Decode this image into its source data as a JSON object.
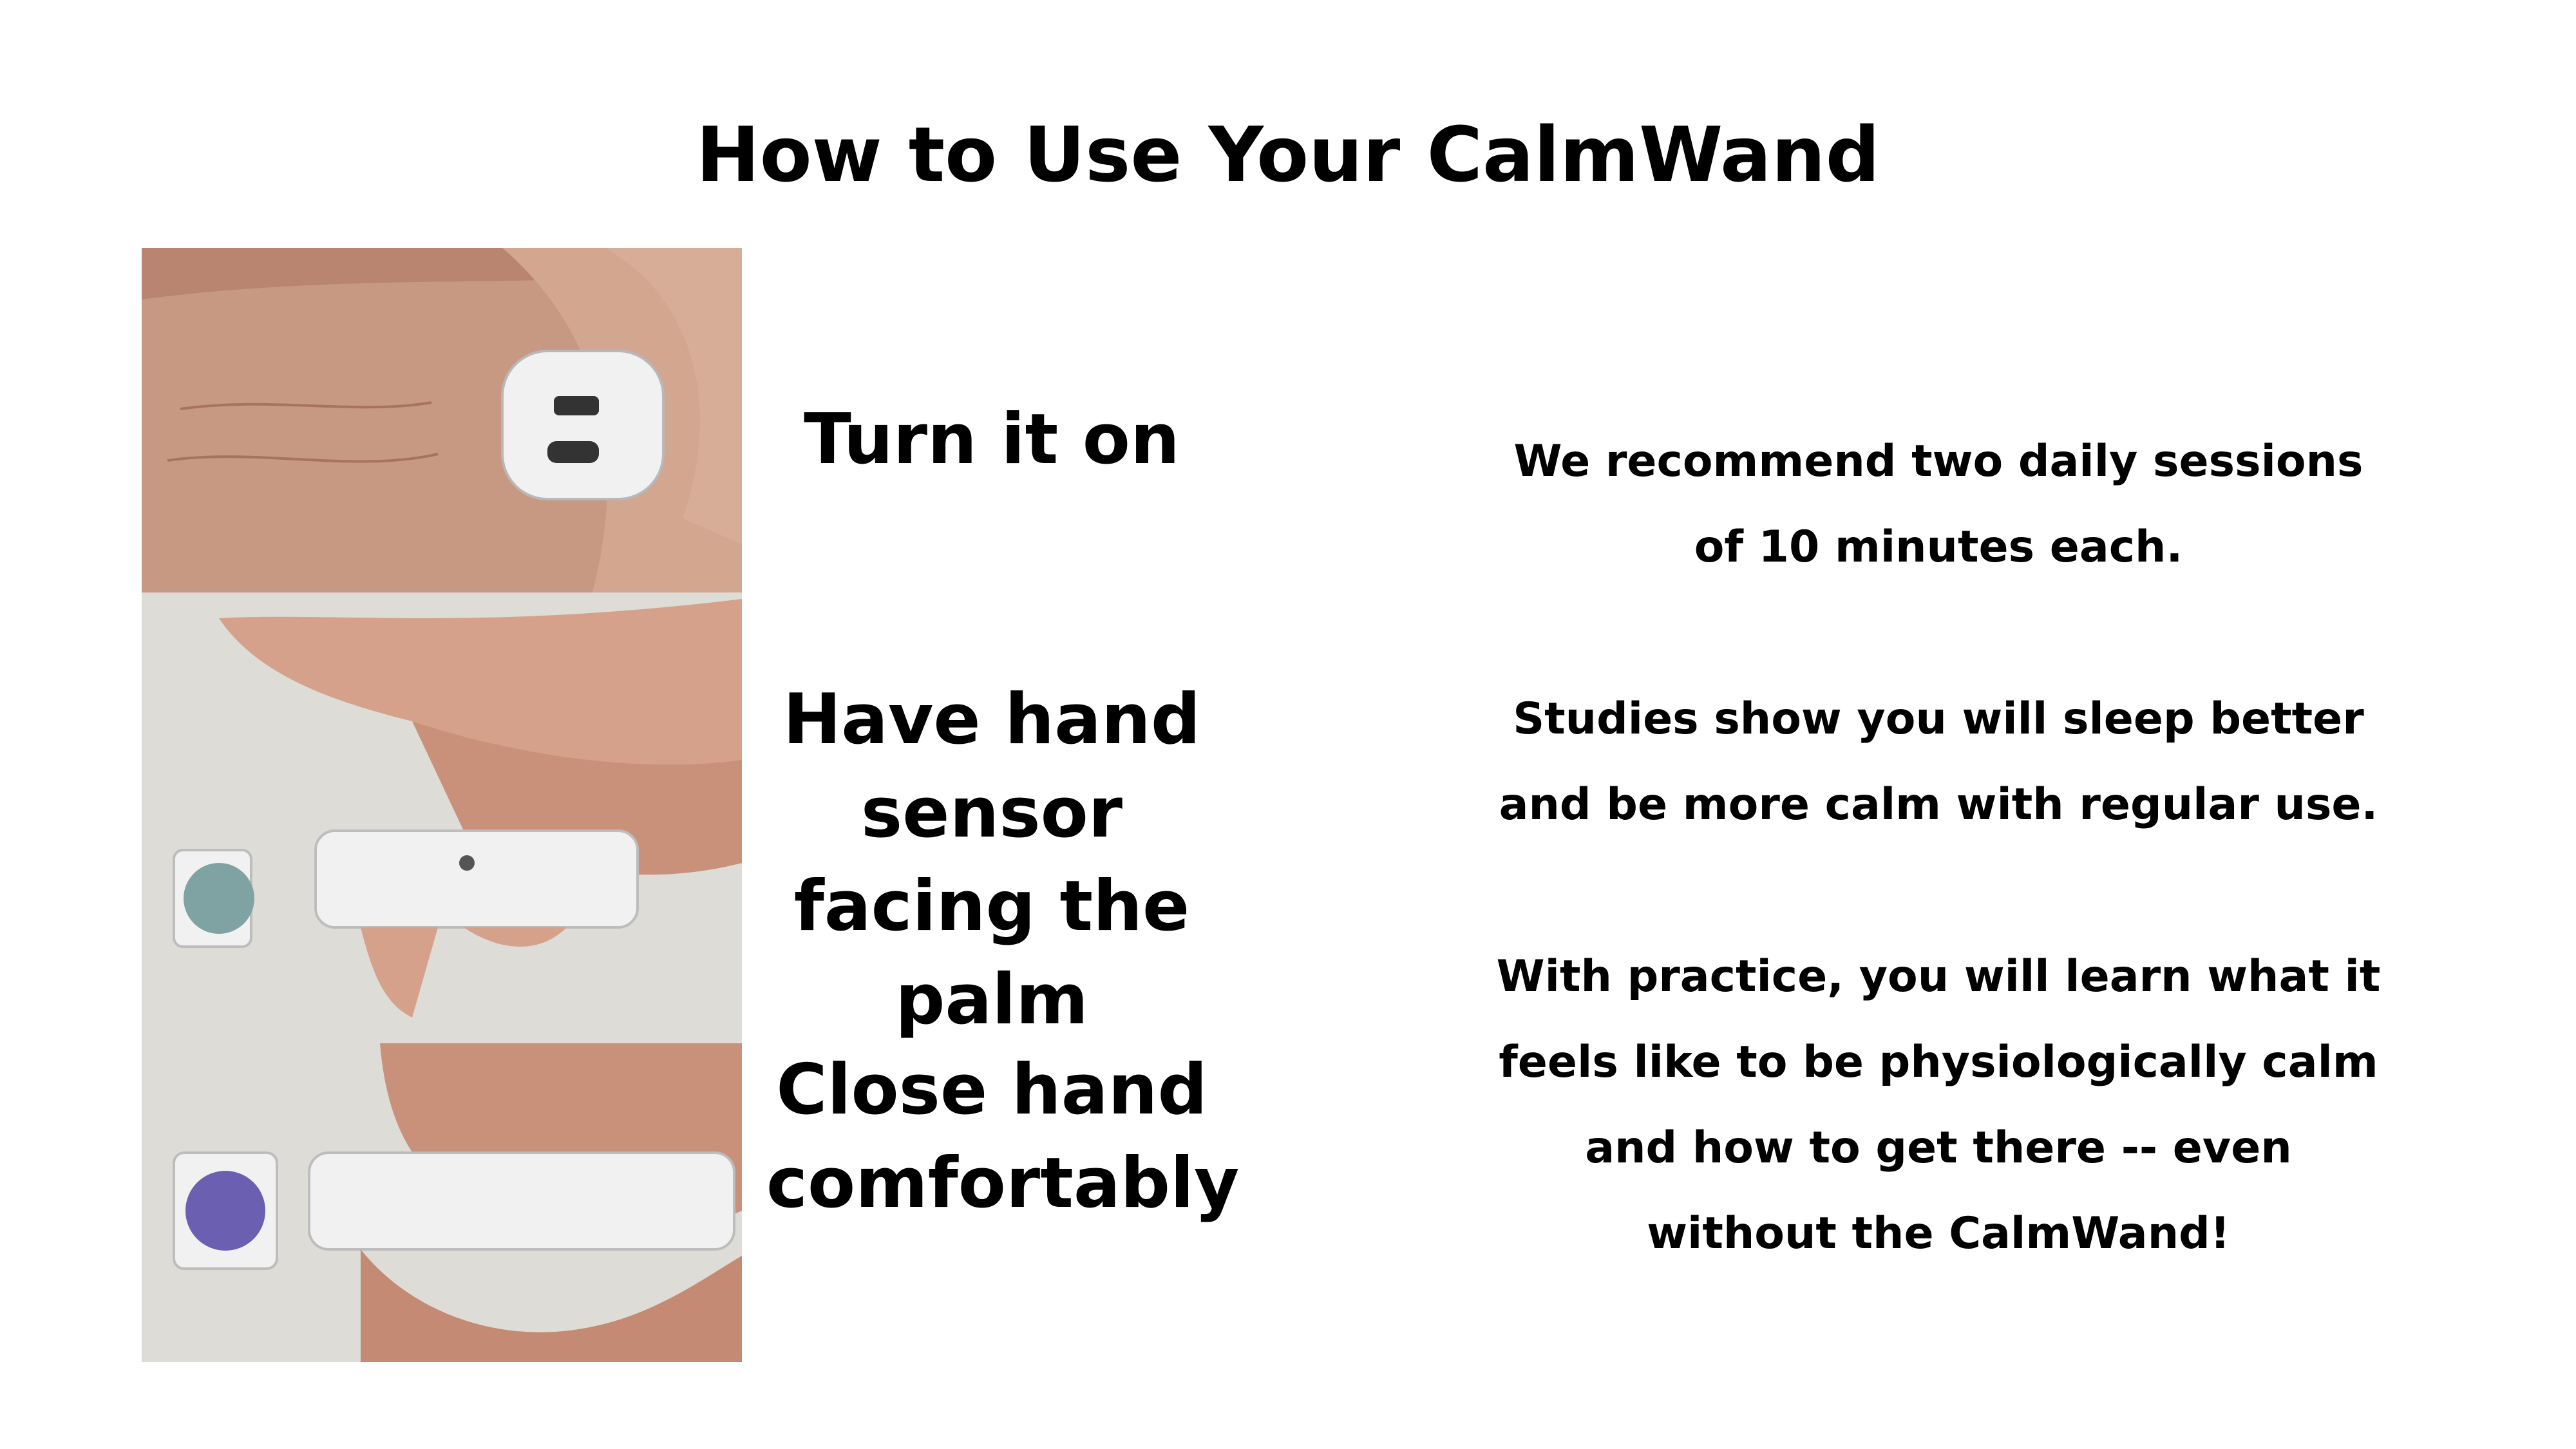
{
  "title": "How to Use Your CalmWand",
  "steps": [
    {
      "label": "Turn it on"
    },
    {
      "label": "Have hand sensor facing the palm"
    },
    {
      "label": "Close hand comfortably"
    }
  ],
  "notes": [
    "We recommend two daily sessions of 10 minutes each.",
    "Studies show you will sleep better and be more calm with regular use.",
    "With practice, you will learn what it feels like to be physiologically calm and how to get there -- even without the CalmWand!"
  ],
  "colors": {
    "background": "#ffffff",
    "text": "#000000",
    "skin": "#c99680",
    "device": "#f1f1f1",
    "floor": "#d9d7d2"
  }
}
